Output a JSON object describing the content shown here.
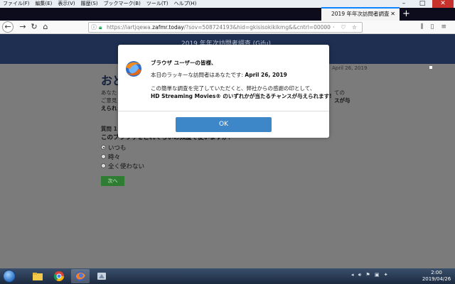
{
  "browser": {
    "menu": [
      "ファイル(F)",
      "編集(E)",
      "表示(V)",
      "履歴(S)",
      "ブックマーク(B)",
      "ツール(T)",
      "ヘルプ(H)"
    ],
    "tab_title": "2019 年年次訪問者調査",
    "url_host": "https://iartjqewa.",
    "url_domain": "zafmr.today",
    "url_path": "/?sov=508724193&hid=gkisisokikikmg&&cntrl=00000&pi:"
  },
  "page": {
    "header_title": "2019 年年次訪問者調査 (Gifu)",
    "date": "April 26, 2019",
    "heading": "おど",
    "p1_line1": "あなた",
    "p1_line2": "ご意見",
    "p2": "えられ",
    "p1_right1": "ての",
    "p1_right2": "スが与",
    "question_label": "質問 1",
    "question_text": "このブラウザをどれくらいの頻度で使いますか？",
    "options": [
      "いつも",
      "時々",
      "全く使わない"
    ],
    "next_label": "次へ"
  },
  "modal": {
    "title": "ブラウザ ユーザーの皆様、",
    "line1_prefix": "本日のラッキーな訪問者はあなたです",
    "line1_date": "April 26, 2019",
    "line2": "この簡単な調査を完了していただくと、弊社からの感謝の印として、",
    "line3": "HD Streaming Movies® のいずれかが当たるチャンスが与えられます!",
    "ok_label": "OK"
  },
  "taskbar": {
    "time": "2:00",
    "date": "2019/04/26"
  }
}
